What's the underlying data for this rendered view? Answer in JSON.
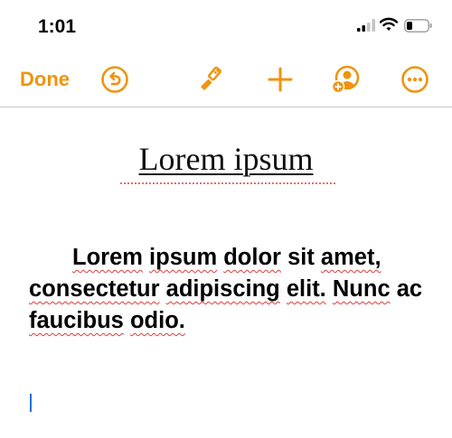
{
  "status_bar": {
    "time": "1:01"
  },
  "toolbar": {
    "done_label": "Done",
    "icons": [
      "undo-icon",
      "paintbrush-icon",
      "plus-icon",
      "collaborate-icon",
      "more-icon"
    ],
    "accent_color": "#f0930f"
  },
  "document": {
    "title": "Lorem ipsum",
    "body_words": [
      "Lorem",
      "ipsum",
      "dolor",
      "sit",
      "amet,",
      "consectetur",
      "adipiscing",
      "elit.",
      "Nunc",
      "ac",
      "faucibus",
      "odio."
    ]
  },
  "colors": {
    "spellcheck": "#e03a3a",
    "cursor": "#1e6fe0"
  }
}
